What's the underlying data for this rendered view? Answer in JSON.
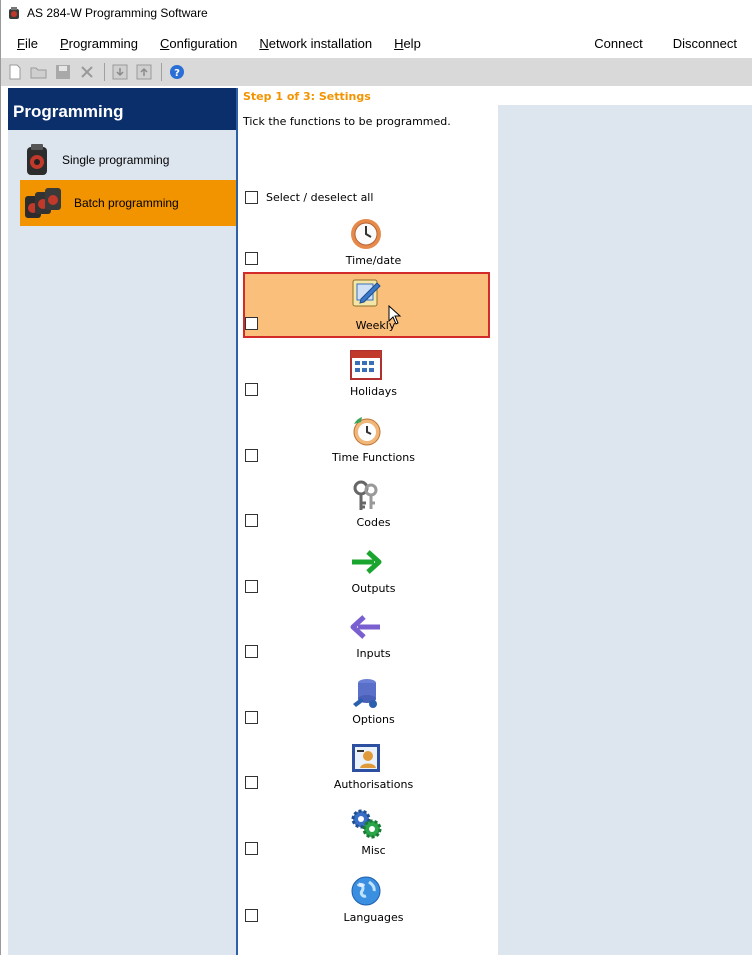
{
  "window": {
    "title": "AS 284-W Programming Software"
  },
  "menu": {
    "items": [
      {
        "label": "File",
        "mnemonic": "F",
        "rest": "ile"
      },
      {
        "label": "Programming",
        "mnemonic": "P",
        "rest": "rogramming"
      },
      {
        "label": "Configuration",
        "mnemonic": "C",
        "rest": "onfiguration"
      },
      {
        "label": "Network installation",
        "mnemonic": "N",
        "rest": "etwork installation"
      },
      {
        "label": "Help",
        "mnemonic": "H",
        "rest": "elp"
      }
    ],
    "right_items": [
      {
        "label": "Connect"
      },
      {
        "label": "Disconnect"
      }
    ]
  },
  "toolbar": {
    "buttons": [
      {
        "icon": "new-document-icon"
      },
      {
        "icon": "open-folder-icon"
      },
      {
        "icon": "save-icon"
      },
      {
        "icon": "delete-icon"
      },
      {
        "icon": "download-icon"
      },
      {
        "icon": "upload-icon"
      },
      {
        "icon": "help-icon"
      }
    ]
  },
  "sidebar": {
    "header": "Programming",
    "items": [
      {
        "label": "Single programming",
        "active": false,
        "icon": "single-device-icon"
      },
      {
        "label": "Batch programming",
        "active": true,
        "icon": "batch-devices-icon"
      }
    ],
    "active_color": "#f29400"
  },
  "main": {
    "step_title": "Step 1 of 3: Settings",
    "instructions": "Tick the functions to be programmed.",
    "select_all_label": "Select / deselect all",
    "functions": [
      {
        "label": "Time/date",
        "icon": "clock-icon",
        "checked": false,
        "highlighted": false
      },
      {
        "label": "Weekly",
        "icon": "weekly-notepad-icon",
        "checked": false,
        "highlighted": true
      },
      {
        "label": "Holidays",
        "icon": "calendar-icon",
        "checked": false,
        "highlighted": false
      },
      {
        "label": "Time Functions",
        "icon": "time-functions-icon",
        "checked": false,
        "highlighted": false
      },
      {
        "label": "Codes",
        "icon": "keys-icon",
        "checked": false,
        "highlighted": false
      },
      {
        "label": "Outputs",
        "icon": "arrow-right-icon",
        "checked": false,
        "highlighted": false
      },
      {
        "label": "Inputs",
        "icon": "arrow-left-icon",
        "checked": false,
        "highlighted": false
      },
      {
        "label": "Options",
        "icon": "options-icon",
        "checked": false,
        "highlighted": false
      },
      {
        "label": "Authorisations",
        "icon": "authorisations-icon",
        "checked": false,
        "highlighted": false
      },
      {
        "label": "Misc",
        "icon": "gears-icon",
        "checked": false,
        "highlighted": false
      },
      {
        "label": "Languages",
        "icon": "globe-icon",
        "checked": false,
        "highlighted": false
      }
    ]
  },
  "colors": {
    "accent_orange": "#f29400",
    "navy_header": "#0b2f6b",
    "panel_bg": "#dde5ef",
    "highlight_fill": "#fbbf7c",
    "highlight_border": "#d32a2a"
  }
}
